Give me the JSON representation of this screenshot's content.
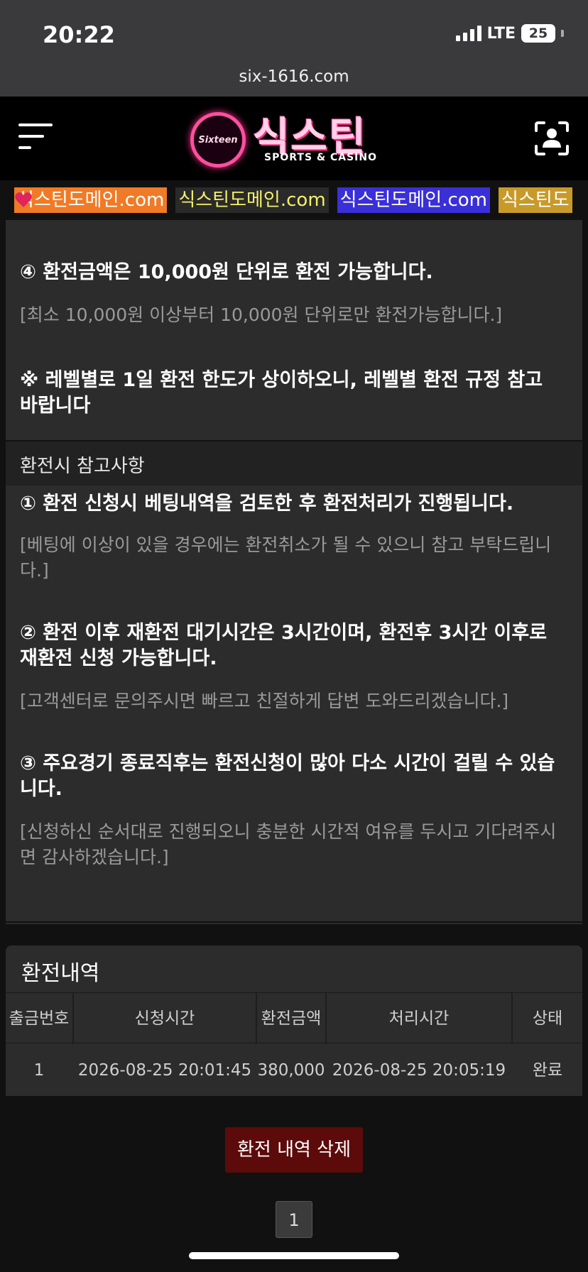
{
  "status_bar": {
    "time": "20:22",
    "network": "LTE",
    "battery": "25"
  },
  "browser": {
    "url": "six-1616.com"
  },
  "header": {
    "logo_circle_text": "Sixteen",
    "logo_text": "식스틴",
    "logo_subtitle": "SPORTS & CASINO"
  },
  "ticker": [
    {
      "label": "식스틴도메인.com",
      "bg": "#f07a26",
      "color": "#ffffff"
    },
    {
      "label": "식스틴도메인.com",
      "bg": "#2a2a2a",
      "color": "#f4f06a"
    },
    {
      "label": "식스틴도메인.com",
      "bg": "#3a30d8",
      "color": "#ffffff"
    },
    {
      "label": "식스틴도",
      "bg": "#c89a2a",
      "color": "#ffffff"
    }
  ],
  "rules": {
    "item4_title": "④ 환전금액은 10,000원 단위로 환전 가능합니다.",
    "item4_note": "[최소 10,000원 이상부터 10,000원 단위로만 환전가능합니다.]",
    "notice": "※ 레벨별로 1일 환전 한도가 상이하오니, 레벨별 환전 규정 참고 바랍니다"
  },
  "reference": {
    "heading": "환전시 참고사항",
    "item1_title": "① 환전 신청시 베팅내역을 검토한 후 환전처리가 진행됩니다.",
    "item1_note": "[베팅에 이상이 있을 경우에는 환전취소가 될 수 있으니 참고 부탁드립니다.]",
    "item2_title": "② 환전 이후 재환전 대기시간은 3시간이며, 환전후 3시간 이후로 재환전 신청 가능합니다.",
    "item2_note": "[고객센터로 문의주시면 빠르고 친절하게 답변 도와드리겠습니다.]",
    "item3_title": "③ 주요경기 종료직후는 환전신청이 많아 다소 시간이 걸릴 수 있습니다.",
    "item3_note": "[신청하신 순서대로 진행되오니 충분한 시간적 여유를 두시고 기다려주시면 감사하겠습니다.]"
  },
  "history": {
    "title": "환전내역",
    "columns": [
      "출금번호",
      "신청시간",
      "환전금액",
      "처리시간",
      "상태"
    ],
    "rows": [
      [
        "1",
        "2026-08-25 20:01:45",
        "380,000",
        "2026-08-25 20:05:19",
        "완료"
      ]
    ]
  },
  "actions": {
    "delete_label": "환전 내역 삭제"
  },
  "pagination": {
    "current": "1"
  }
}
